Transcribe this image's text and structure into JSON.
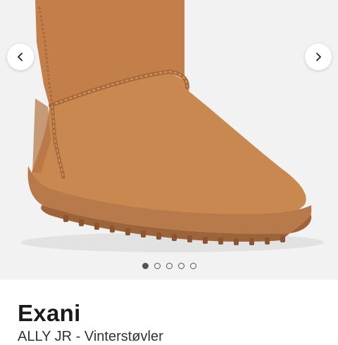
{
  "gallery": {
    "prev_icon": "chevron-left-icon",
    "next_icon": "chevron-right-icon",
    "image_count": 5,
    "active_index": 0
  },
  "product": {
    "brand": "Exani",
    "subtitle": "ALLY JR - Vinterstøvler"
  },
  "colors": {
    "suede": "#c0814c",
    "sole": "#b57849",
    "background": "#f2f2f2"
  }
}
